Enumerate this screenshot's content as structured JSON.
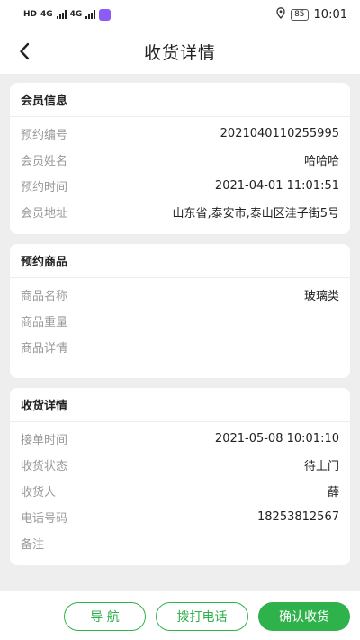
{
  "status_bar": {
    "network_left": "HD",
    "network_1": "4G",
    "network_2": "4G",
    "battery": "85",
    "time": "10:01"
  },
  "header": {
    "title": "收货详情"
  },
  "member": {
    "heading": "会员信息",
    "rows": [
      {
        "key": "预约编号",
        "value": "2021040110255995"
      },
      {
        "key": "会员姓名",
        "value": "哈哈哈"
      },
      {
        "key": "预约时间",
        "value": "2021-04-01 11:01:51"
      },
      {
        "key": "会员地址",
        "value": "山东省,泰安市,泰山区洼子街5号"
      }
    ]
  },
  "goods": {
    "heading": "预约商品",
    "rows": [
      {
        "key": "商品名称",
        "value": "玻璃类"
      },
      {
        "key": "商品重量",
        "value": ""
      },
      {
        "key": "商品详情",
        "value": ""
      }
    ]
  },
  "receipt": {
    "heading": "收货详情",
    "rows": [
      {
        "key": "接单时间",
        "value": "2021-05-08 10:01:10"
      },
      {
        "key": "收货状态",
        "value": "待上门"
      },
      {
        "key": "收货人",
        "value": "薛"
      },
      {
        "key": "电话号码",
        "value": "18253812567"
      },
      {
        "key": "备注",
        "value": ""
      }
    ]
  },
  "actions": {
    "navigate": "导 航",
    "call": "拨打电话",
    "confirm": "确认收货"
  },
  "colors": {
    "accent": "#2fb24b",
    "background": "#eeeeee",
    "label": "#9a9a9a"
  }
}
